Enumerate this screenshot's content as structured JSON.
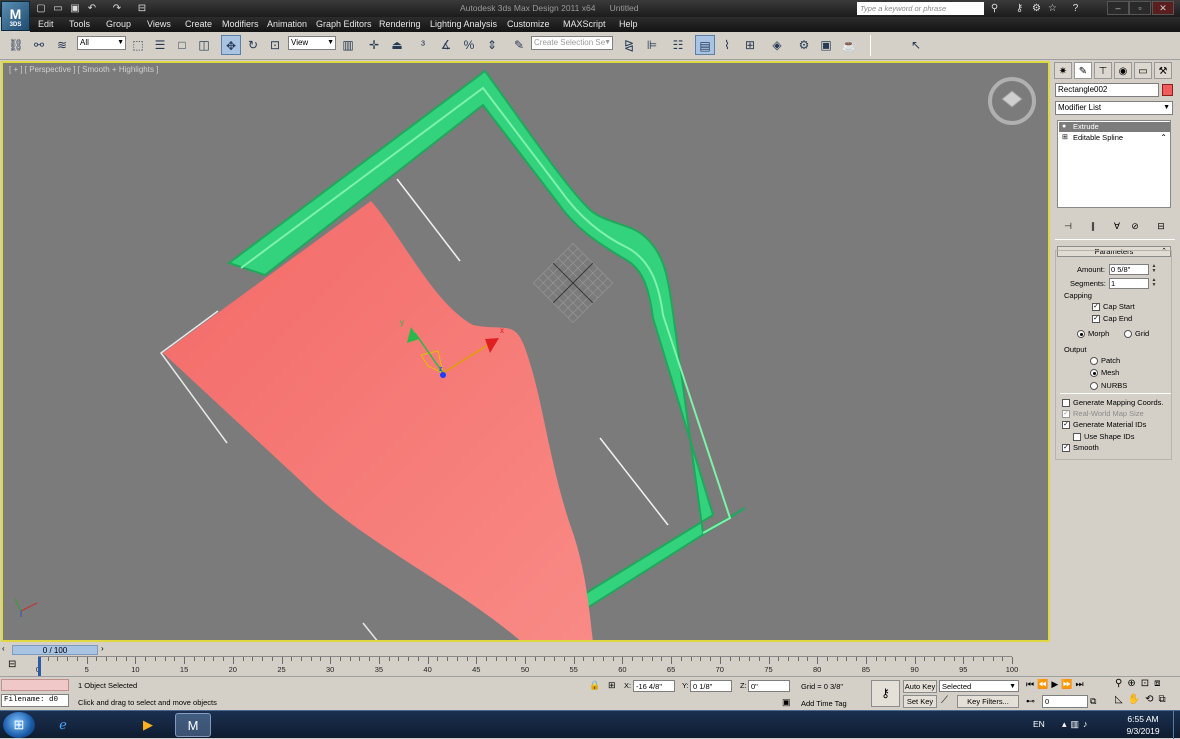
{
  "app": {
    "logo": "M",
    "logo_sub": "3DS",
    "title": "Autodesk 3ds Max Design 2011 x64      Untitled",
    "search_placeholder": "Type a keyword or phrase"
  },
  "menu": [
    "Edit",
    "Tools",
    "Group",
    "Views",
    "Create",
    "Modifiers",
    "Animation",
    "Graph Editors",
    "Rendering",
    "Lighting Analysis",
    "Customize",
    "MAXScript",
    "Help"
  ],
  "toolbar": {
    "selection_filter": "All",
    "ref_coord": "View",
    "named_selection_placeholder": "Create Selection Se"
  },
  "viewport": {
    "label": "[ + ] [ Perspective ] [ Smooth + Highlights ]",
    "gizmo_axes": {
      "x": "x",
      "y": "y",
      "z": "z"
    }
  },
  "command_panel": {
    "object_name": "Rectangle002",
    "object_color": "#f15b5b",
    "modifier_list": "Modifier List",
    "stack": [
      "Extrude",
      "Editable Spline"
    ],
    "rollout_title": "Parameters",
    "amount_label": "Amount:",
    "amount_value": "0 5/8\"",
    "segments_label": "Segments:",
    "segments_value": "1",
    "capping_title": "Capping",
    "cap_start": "Cap Start",
    "cap_end": "Cap End",
    "morph": "Morph",
    "grid": "Grid",
    "output_title": "Output",
    "patch": "Patch",
    "mesh": "Mesh",
    "nurbs": "NURBS",
    "gen_mapping": "Generate Mapping Coords.",
    "real_world": "Real-World Map Size",
    "gen_mat_ids": "Generate Material IDs",
    "use_shape_ids": "Use Shape IDs",
    "smooth": "Smooth"
  },
  "timeline": {
    "slider": "0 / 100",
    "ticks": [
      "0",
      "5",
      "10",
      "15",
      "20",
      "25",
      "30",
      "35",
      "40",
      "45",
      "50",
      "55",
      "60",
      "65",
      "70",
      "75",
      "80",
      "85",
      "90",
      "95",
      "100"
    ]
  },
  "status": {
    "maxscript_label": "Filename: d0",
    "selected": "1 Object Selected",
    "prompt": "Click and drag to select and move objects",
    "x_label": "X:",
    "x_value": "-16 4/8\"",
    "y_label": "Y:",
    "y_value": "0 1/8\"",
    "z_label": "Z:",
    "z_value": "0\"",
    "grid": "Grid = 0 3/8\"",
    "add_time_tag": "Add Time Tag",
    "auto_key": "Auto Key",
    "set_key": "Set Key",
    "key_mode": "Selected",
    "key_filters": "Key Filters...",
    "frame": "0"
  },
  "taskbar": {
    "lang": "EN",
    "time": "6:55 AM",
    "date": "9/3/2019"
  }
}
